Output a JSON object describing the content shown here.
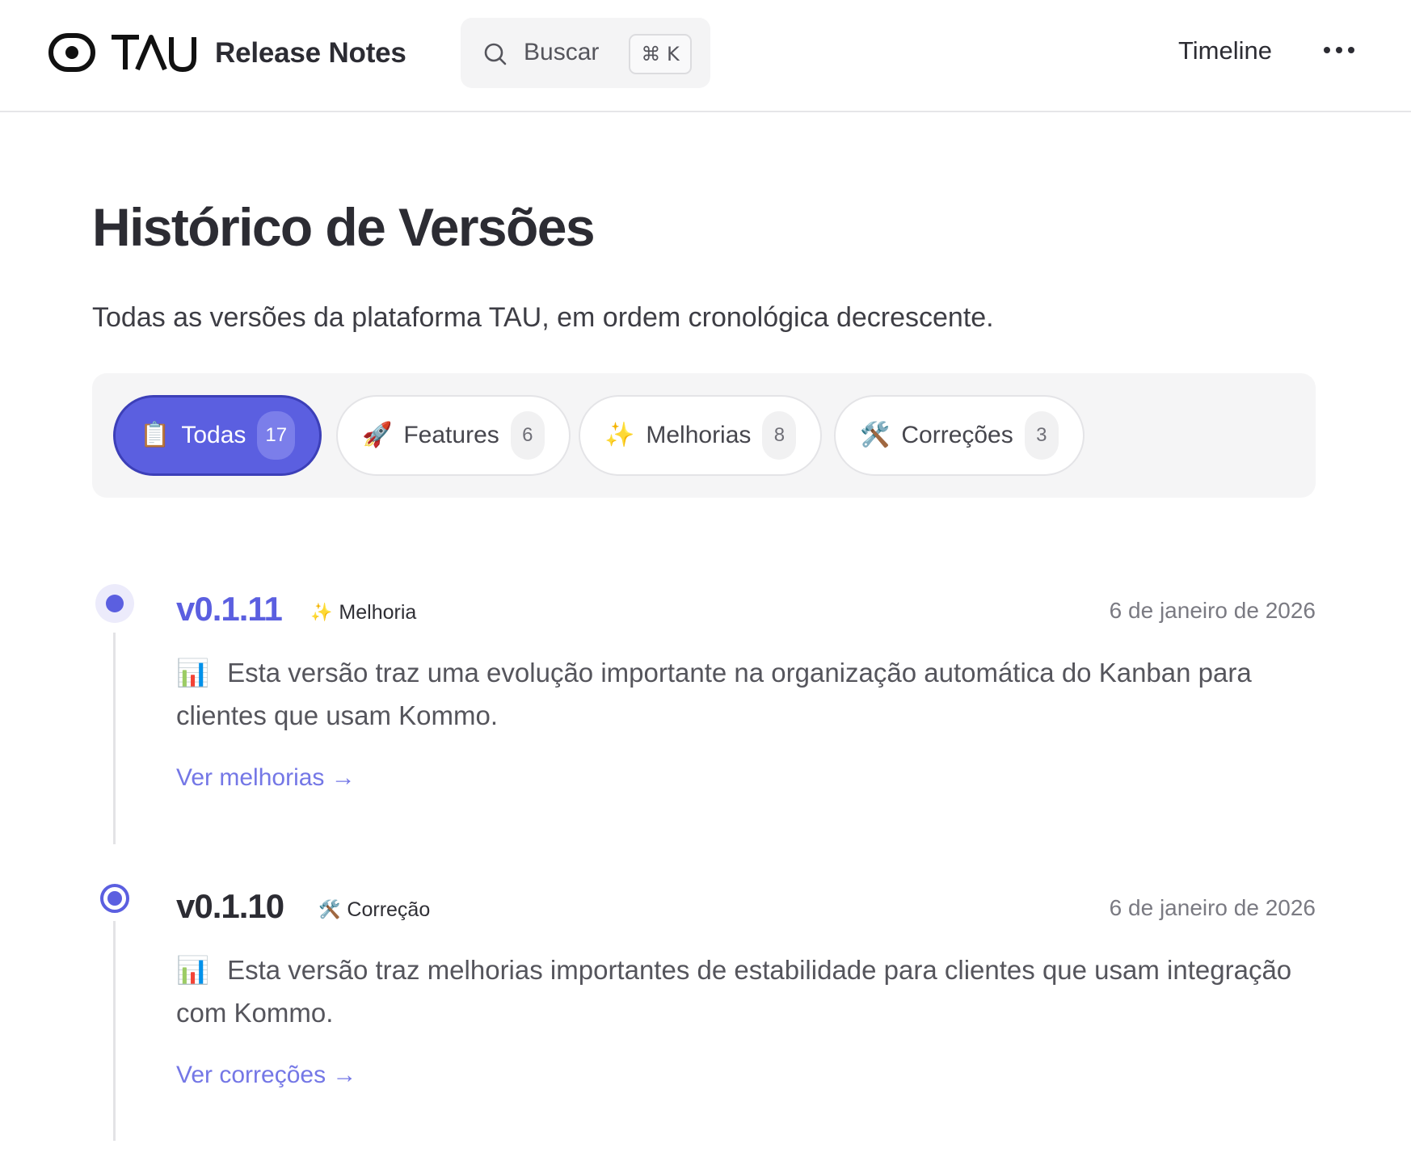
{
  "header": {
    "brand": "TAU",
    "title": "Release Notes",
    "search": {
      "placeholder": "Buscar",
      "shortcut": "⌘ K"
    },
    "nav_timeline": "Timeline"
  },
  "hero": {
    "title": "Histórico de Versões",
    "subtitle": "Todas as versões da plataforma TAU, em ordem cronológica decrescente."
  },
  "filters": [
    {
      "emoji": "📋",
      "label": "Todas",
      "count": "17",
      "active": true
    },
    {
      "emoji": "🚀",
      "label": "Features",
      "count": "6",
      "active": false
    },
    {
      "emoji": "✨",
      "label": "Melhorias",
      "count": "8",
      "active": false
    },
    {
      "emoji": "🛠️",
      "label": "Correções",
      "count": "3",
      "active": false
    }
  ],
  "releases": [
    {
      "version": "v0.1.11",
      "type_emoji": "✨",
      "type": "Melhoria",
      "date": "6 de janeiro de 2026",
      "emoji": "📊",
      "description": "Esta versão traz uma evolução importante na organização automática do Kanban para clientes que usam Kommo.",
      "link": "Ver melhorias →"
    },
    {
      "version": "v0.1.10",
      "type_emoji": "🛠️",
      "type": "Correção",
      "date": "6 de janeiro de 2026",
      "emoji": "📊",
      "description": "Esta versão traz melhorias importantes de estabilidade para clientes que usam integração com Kommo.",
      "link": "Ver correções →"
    }
  ],
  "colors": {
    "accent": "#5b5fe0",
    "link": "#7477e6",
    "text": "#2c2c33",
    "muted": "#7a7a82"
  }
}
